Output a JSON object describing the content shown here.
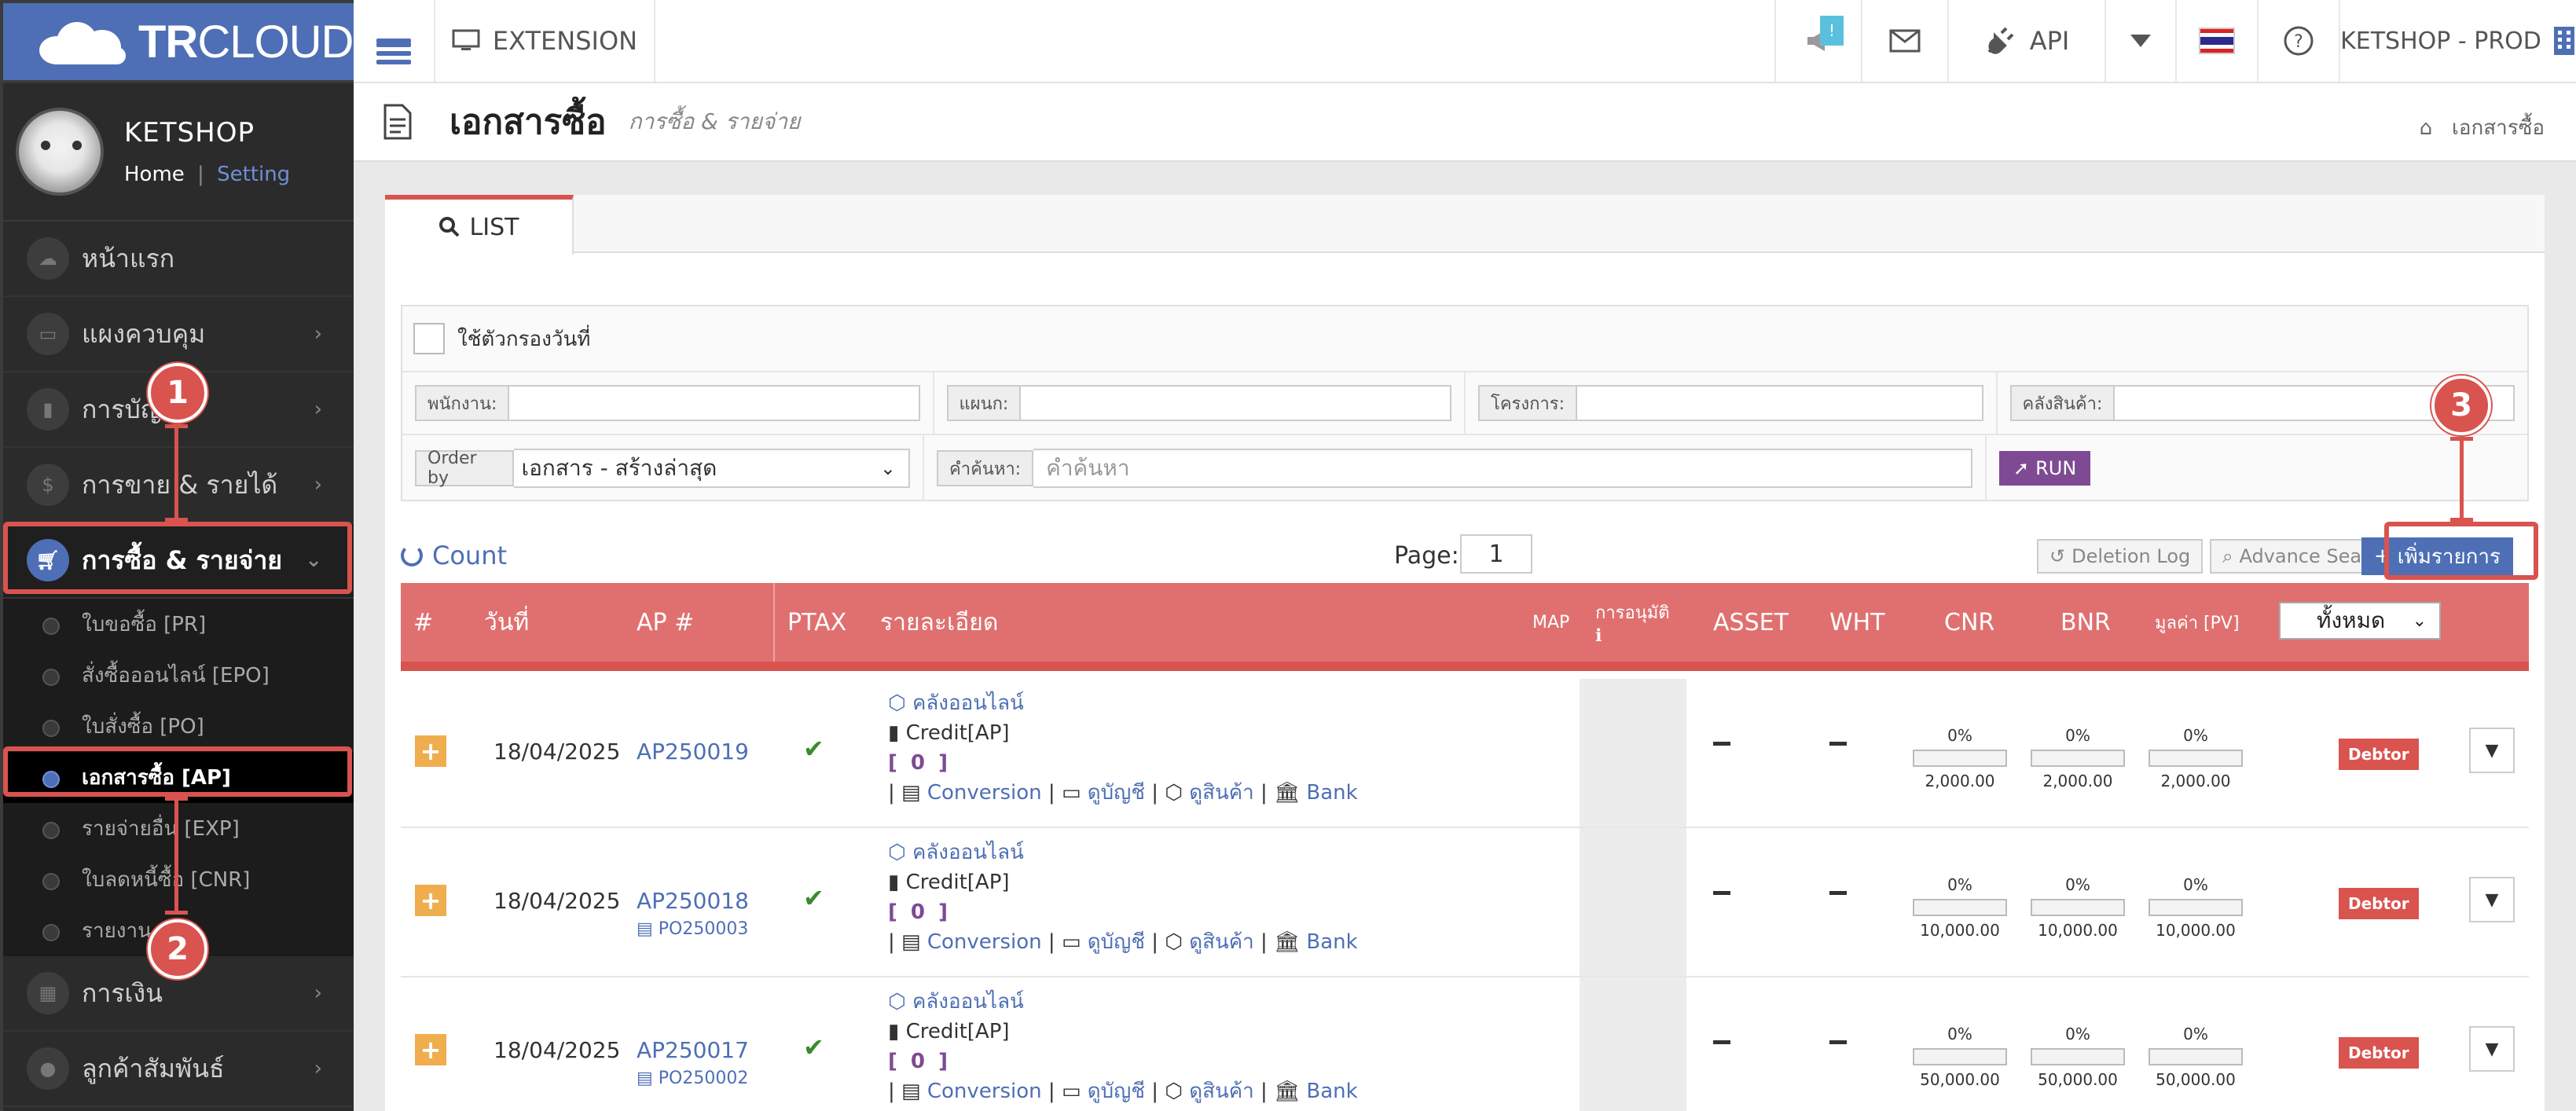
{
  "topbar": {
    "logo_bold": "TR",
    "logo_rest": "CLOUD",
    "extension_label": "EXTENSION",
    "notif_count": "!",
    "api_label": "API",
    "env_label": "KETSHOP - PROD"
  },
  "profile": {
    "name": "KETSHOP",
    "home": "Home",
    "sep": "|",
    "setting": "Setting"
  },
  "sidebar": {
    "items": [
      {
        "label": "หน้าแรก",
        "icon": "cloud-icon"
      },
      {
        "label": "แผงควบคุม",
        "icon": "monitor-icon"
      },
      {
        "label": "การบัญชี",
        "icon": "book-icon"
      },
      {
        "label": "การขาย & รายได้",
        "icon": "dollar-icon"
      },
      {
        "label": "การซื้อ & รายจ่าย",
        "icon": "cart-icon"
      }
    ],
    "sub_items": [
      "ใบขอซื้อ [PR]",
      "สั่งซื้อออนไลน์ [EPO]",
      "ใบสั่งซื้อ [PO]",
      "เอกสารซื้อ [AP]",
      "รายจ่ายอื่น [EXP]",
      "ใบลดหนี้ซื้อ [CNR]",
      "รายงานภาษี"
    ],
    "bottom_items": [
      {
        "label": "การเงิน",
        "icon": "calendar-icon"
      },
      {
        "label": "ลูกค้าสัมพันธ์",
        "icon": "users-icon"
      }
    ]
  },
  "annotations": [
    "1",
    "2",
    "3"
  ],
  "page": {
    "title": "เอกสารซื้อ",
    "subtitle": "การซื้อ & รายจ่าย",
    "breadcrumb": "เอกสารซื้อ"
  },
  "tab_list": "LIST",
  "filter": {
    "date_filter": "ใช้ตัวกรองวันที่",
    "employee": "พนักงาน:",
    "department": "แผนก:",
    "project": "โครงการ:",
    "warehouse": "คลังสินค้า:",
    "order_by": "Order by",
    "order_value": "เอกสาร - สร้างล่าสุด",
    "search_label": "คำค้นหา:",
    "search_placeholder": "คำค้นหา",
    "run": "RUN"
  },
  "toolbar": {
    "count": "Count",
    "page_label": "Page:",
    "page_value": "1",
    "deletion_log": "Deletion Log",
    "advance_search": "Advance Search",
    "add": "เพิ่มรายการ"
  },
  "table": {
    "headers": [
      "#",
      "วันที่",
      "AP #",
      "PTAX",
      "รายละเอียด",
      "MAP",
      "การอนุมัติ",
      "ASSET",
      "WHT",
      "CNR",
      "BNR",
      "มูลค่า [PV]"
    ],
    "filter_value": "ทั้งหมด",
    "rows": [
      {
        "date": "18/04/2025",
        "ap": "AP250019",
        "po": "",
        "warehouse": "คลังออนไลน์",
        "credit": "Credit[AP]",
        "bracket": "[ 0 ]",
        "conv": "Conversion",
        "acc": "ดูบัญชี",
        "prod": "ดูสินค้า",
        "bank": "Bank",
        "pct": "0%",
        "cnr": "2,000.00",
        "bnr": "2,000.00",
        "pv": "2,000.00",
        "status": "Debtor"
      },
      {
        "date": "18/04/2025",
        "ap": "AP250018",
        "po": "PO250003",
        "warehouse": "คลังออนไลน์",
        "credit": "Credit[AP]",
        "bracket": "[ 0 ]",
        "conv": "Conversion",
        "acc": "ดูบัญชี",
        "prod": "ดูสินค้า",
        "bank": "Bank",
        "pct": "0%",
        "cnr": "10,000.00",
        "bnr": "10,000.00",
        "pv": "10,000.00",
        "status": "Debtor"
      },
      {
        "date": "18/04/2025",
        "ap": "AP250017",
        "po": "PO250002",
        "warehouse": "คลังออนไลน์",
        "credit": "Credit[AP]",
        "bracket": "[ 0 ]",
        "conv": "Conversion",
        "acc": "ดูบัญชี",
        "prod": "ดูสินค้า",
        "bank": "Bank",
        "pct": "0%",
        "cnr": "50,000.00",
        "bnr": "50,000.00",
        "pv": "50,000.00",
        "status": "Debtor"
      }
    ]
  },
  "colors": {
    "brand": "#4e6fb5",
    "header": "#e07070",
    "highlight": "#d9534f"
  }
}
